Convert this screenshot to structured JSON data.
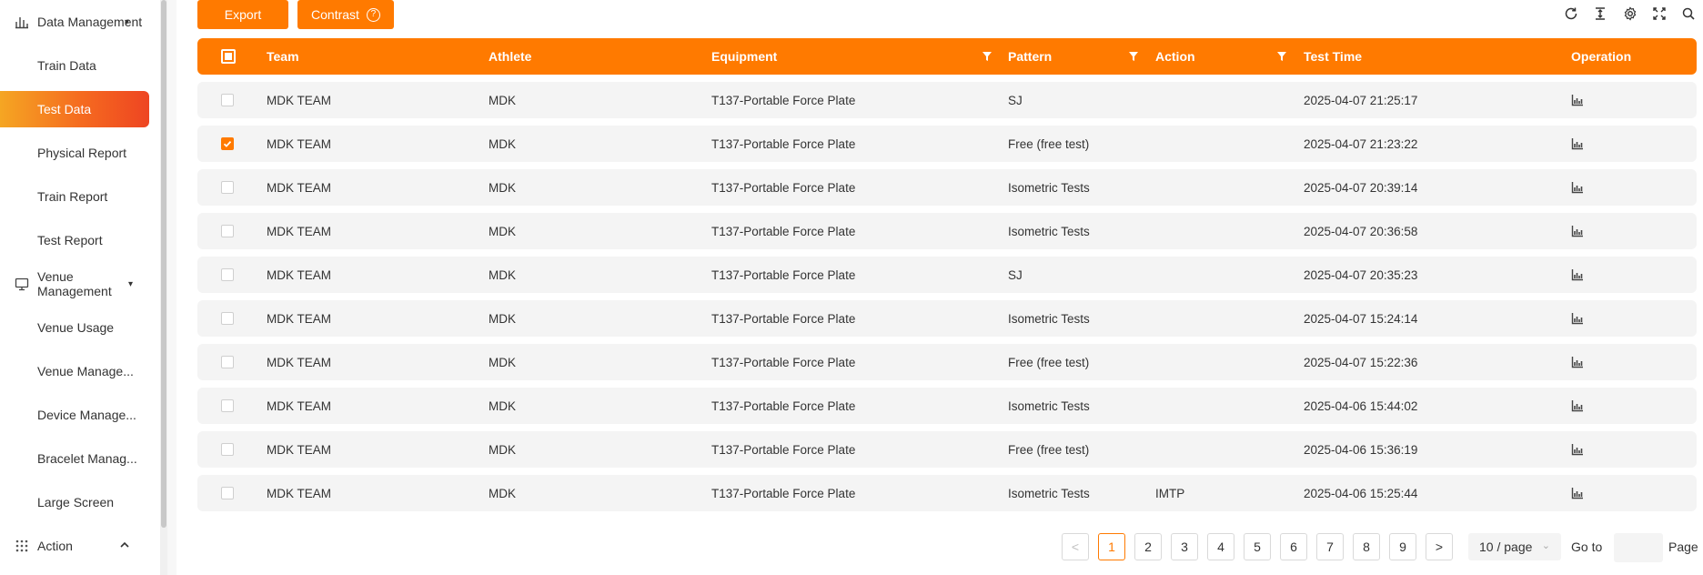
{
  "colors": {
    "accent": "#ff7a00",
    "active_gradient_start": "#f5a623",
    "active_gradient_end": "#ee4522",
    "row_bg": "#f4f4f4"
  },
  "sidebar": {
    "data_management": {
      "label": "Data Management",
      "icon": "bar-chart-icon"
    },
    "items": [
      {
        "label": "Train Data"
      },
      {
        "label": "Test Data",
        "active": true
      },
      {
        "label": "Physical Report"
      },
      {
        "label": "Train Report"
      },
      {
        "label": "Test Report"
      }
    ],
    "venue_management": {
      "label": "Venue Management",
      "icon": "monitor-icon"
    },
    "venue_items": [
      {
        "label": "Venue Usage"
      },
      {
        "label": "Venue Manage..."
      },
      {
        "label": "Device Manage..."
      },
      {
        "label": "Bracelet Manag..."
      },
      {
        "label": "Large Screen"
      }
    ],
    "action": {
      "label": "Action",
      "icon": "apps-grid-icon"
    }
  },
  "toolbar": {
    "export_label": "Export",
    "contrast_label": "Contrast",
    "icons": [
      "refresh-icon",
      "column-height-icon",
      "settings-icon",
      "fullscreen-icon",
      "search-icon"
    ]
  },
  "table": {
    "columns": {
      "team": "Team",
      "athlete": "Athlete",
      "equipment": "Equipment",
      "pattern": "Pattern",
      "action": "Action",
      "test_time": "Test Time",
      "operation": "Operation"
    },
    "rows": [
      {
        "checked": false,
        "team": "MDK TEAM",
        "athlete": "MDK",
        "equipment": "T137-Portable Force Plate",
        "pattern": "SJ",
        "action": "",
        "test_time": "2025-04-07 21:25:17"
      },
      {
        "checked": true,
        "team": "MDK TEAM",
        "athlete": "MDK",
        "equipment": "T137-Portable Force Plate",
        "pattern": "Free (free test)",
        "action": "",
        "test_time": "2025-04-07 21:23:22"
      },
      {
        "checked": false,
        "team": "MDK TEAM",
        "athlete": "MDK",
        "equipment": "T137-Portable Force Plate",
        "pattern": "Isometric Tests",
        "action": "",
        "test_time": "2025-04-07 20:39:14"
      },
      {
        "checked": false,
        "team": "MDK TEAM",
        "athlete": "MDK",
        "equipment": "T137-Portable Force Plate",
        "pattern": "Isometric Tests",
        "action": "",
        "test_time": "2025-04-07 20:36:58"
      },
      {
        "checked": false,
        "team": "MDK TEAM",
        "athlete": "MDK",
        "equipment": "T137-Portable Force Plate",
        "pattern": "SJ",
        "action": "",
        "test_time": "2025-04-07 20:35:23"
      },
      {
        "checked": false,
        "team": "MDK TEAM",
        "athlete": "MDK",
        "equipment": "T137-Portable Force Plate",
        "pattern": "Isometric Tests",
        "action": "",
        "test_time": "2025-04-07 15:24:14"
      },
      {
        "checked": false,
        "team": "MDK TEAM",
        "athlete": "MDK",
        "equipment": "T137-Portable Force Plate",
        "pattern": "Free (free test)",
        "action": "",
        "test_time": "2025-04-07 15:22:36"
      },
      {
        "checked": false,
        "team": "MDK TEAM",
        "athlete": "MDK",
        "equipment": "T137-Portable Force Plate",
        "pattern": "Isometric Tests",
        "action": "",
        "test_time": "2025-04-06 15:44:02"
      },
      {
        "checked": false,
        "team": "MDK TEAM",
        "athlete": "MDK",
        "equipment": "T137-Portable Force Plate",
        "pattern": "Free (free test)",
        "action": "",
        "test_time": "2025-04-06 15:36:19"
      },
      {
        "checked": false,
        "team": "MDK TEAM",
        "athlete": "MDK",
        "equipment": "T137-Portable Force Plate",
        "pattern": "Isometric Tests",
        "action": "IMTP",
        "test_time": "2025-04-06 15:25:44"
      }
    ]
  },
  "pagination": {
    "prev": "<",
    "pages": [
      "1",
      "2",
      "3",
      "4",
      "5",
      "6",
      "7",
      "8",
      "9"
    ],
    "current": "1",
    "next": ">",
    "page_size": "10 / page",
    "goto_label": "Go to",
    "page_label": "Page"
  }
}
